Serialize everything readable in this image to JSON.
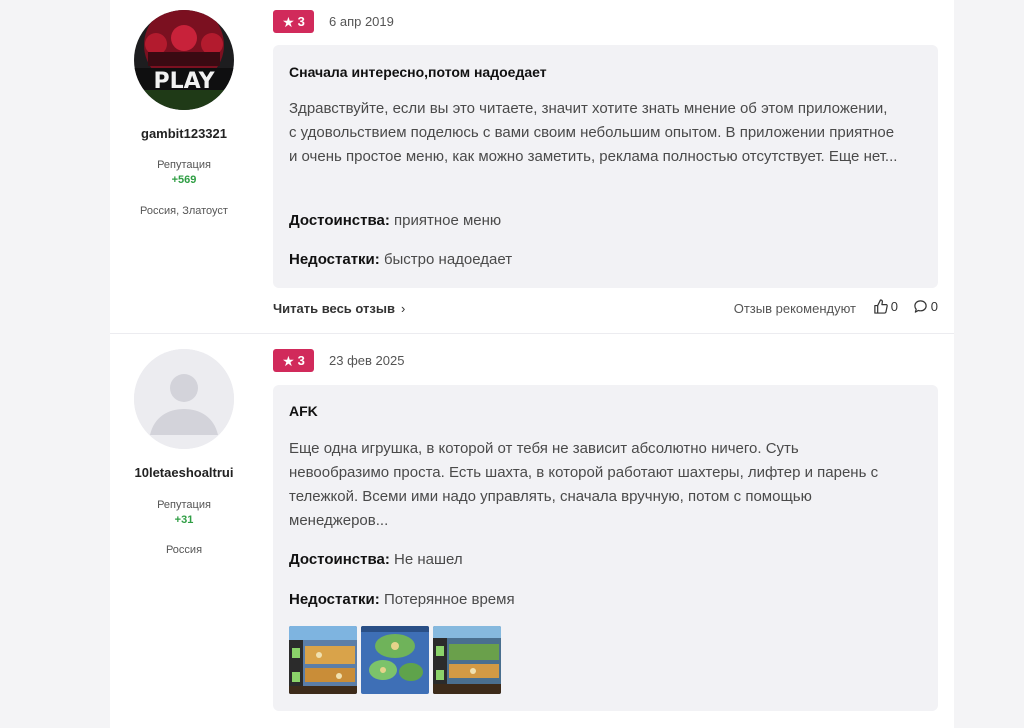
{
  "reviews": [
    {
      "author": {
        "username": "gambit123321",
        "avatar_text": "PLAY",
        "reputation_label": "Репутация",
        "reputation_value": "+569",
        "location": "Россия, Златоуст"
      },
      "rating": "3",
      "date": "6 апр 2019",
      "title": "Сначала интересно,потом надоедает",
      "body": "Здравствуйте, если вы это читаете, значит хотите знать мнение об этом приложении, с удовольствием поделюсь с вами своим небольшим опытом. В приложении приятное и очень простое меню, как можно заметить, реклама полностью отсутствует. Еще нет...",
      "pros_label": "Достоинства:",
      "pros": "приятное меню",
      "cons_label": "Недостатки:",
      "cons": "быстро надоедает",
      "read_more": "Читать весь отзыв",
      "recommend": "Отзыв рекомендуют",
      "likes": "0",
      "comments": "0"
    },
    {
      "author": {
        "username": "10letaeshoaltrui",
        "reputation_label": "Репутация",
        "reputation_value": "+31",
        "location": "Россия"
      },
      "rating": "3",
      "date": "23 фев 2025",
      "title": "AFK",
      "body": "Еще одна игрушка, в которой от тебя не зависит абсолютно ничего. Суть невообразимо проста. Есть шахта, в которой работают шахтеры, лифтер и парень с тележкой. Всеми ими надо управлять, сначала вручную, потом с помощью менеджеров...",
      "pros_label": "Достоинства:",
      "pros": "Не нашел",
      "cons_label": "Недостатки:",
      "cons": "Потерянное время",
      "thumbnails": [
        "screenshot-thumbnail-1",
        "screenshot-thumbnail-2",
        "screenshot-thumbnail-3"
      ]
    }
  ],
  "icons": {
    "star": "star-icon",
    "chevron": "chevron-right-icon",
    "like": "thumbs-up-icon",
    "comment": "comment-bubble-icon"
  },
  "colors": {
    "rating_badge": "#d12a5b",
    "reputation": "#2f9e44",
    "card_bg": "#f2f2f5"
  }
}
